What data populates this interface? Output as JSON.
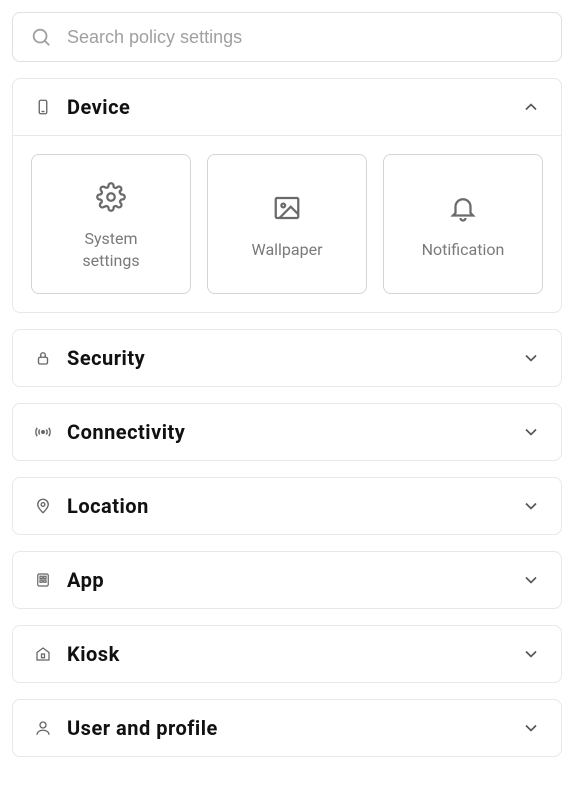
{
  "search": {
    "placeholder": "Search policy settings",
    "value": ""
  },
  "sections": [
    {
      "id": "device",
      "label": "Device",
      "icon": "device-icon",
      "expanded": true
    },
    {
      "id": "security",
      "label": "Security",
      "icon": "lock-icon",
      "expanded": false
    },
    {
      "id": "connectivity",
      "label": "Connectivity",
      "icon": "signal-icon",
      "expanded": false
    },
    {
      "id": "location",
      "label": "Location",
      "icon": "pin-icon",
      "expanded": false
    },
    {
      "id": "app",
      "label": "App",
      "icon": "app-icon",
      "expanded": false
    },
    {
      "id": "kiosk",
      "label": "Kiosk",
      "icon": "kiosk-icon",
      "expanded": false
    },
    {
      "id": "user",
      "label": "User and profile",
      "icon": "user-icon",
      "expanded": false
    }
  ],
  "device_tiles": [
    {
      "id": "system-settings",
      "label": "System\nsettings",
      "icon": "gear-icon"
    },
    {
      "id": "wallpaper",
      "label": "Wallpaper",
      "icon": "image-icon"
    },
    {
      "id": "notification",
      "label": "Notification",
      "icon": "bell-icon"
    }
  ]
}
